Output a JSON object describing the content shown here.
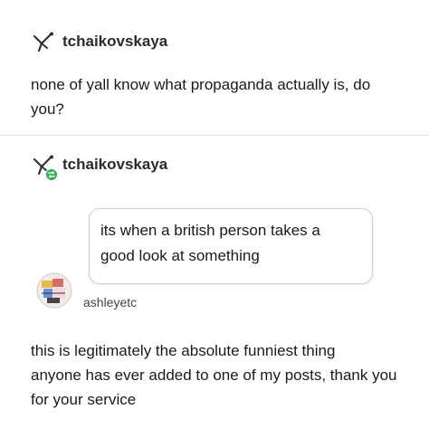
{
  "post": {
    "author": "tchaikovskaya",
    "text_line1": "none of yall know what propaganda actually is, do",
    "text_line2": "you?"
  },
  "reblog": {
    "author": "tchaikovskaya",
    "reblog_badge_color": "#2bb24c"
  },
  "reply": {
    "bubble_line1": "its when a british person takes a",
    "bubble_line2": "good look at something",
    "author": "ashleyetc"
  },
  "comment": {
    "line1": "this is legitimately the absolute funniest thing",
    "line2": "anyone has ever added to one of my posts, thank you",
    "line3": "for your service"
  }
}
